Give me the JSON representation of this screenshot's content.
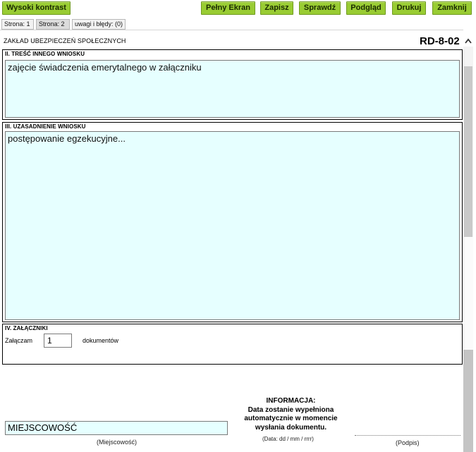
{
  "toolbar": {
    "high_contrast": "Wysoki kontrast",
    "fullscreen": "Pełny Ekran",
    "save": "Zapisz",
    "check": "Sprawdź",
    "preview": "Podgląd",
    "print": "Drukuj",
    "close": "Zamknij"
  },
  "tabs": [
    {
      "label": "Strona: 1"
    },
    {
      "label": "Strona: 2"
    },
    {
      "label": "uwagi i błędy: (0)"
    }
  ],
  "form": {
    "institution": "ZAKŁAD UBEZPIECZEŃ SPOŁECZNYCH",
    "code": "RD-8-02",
    "section2": {
      "title": "II. TREŚĆ INNEGO WNIOSKU",
      "value": "zajęcie świadczenia emerytalnego w załączniku"
    },
    "section3": {
      "title": "III. UZASADNIENIE WNIOSKU",
      "value": "postępowanie egzekucyjne..."
    },
    "section4": {
      "title": "IV. ZAŁĄCZNIKI",
      "attach_prefix": "Załączam",
      "attach_count": "1",
      "attach_suffix": "dokumentów"
    },
    "footer": {
      "place_value": "MIEJSCOWOŚĆ",
      "place_caption": "(Miejscowość)",
      "info_title": "INFORMACJA:",
      "info_line1": "Data zostanie wypełniona",
      "info_line2": "automatycznie w momencie",
      "info_line3": "wysłania dokumentu.",
      "date_caption": "(Data: dd / mm / rrrr)",
      "sign_caption": "(Podpis)"
    }
  },
  "colors": {
    "button_bg": "#99cc33",
    "field_bg": "#e6ffff"
  }
}
